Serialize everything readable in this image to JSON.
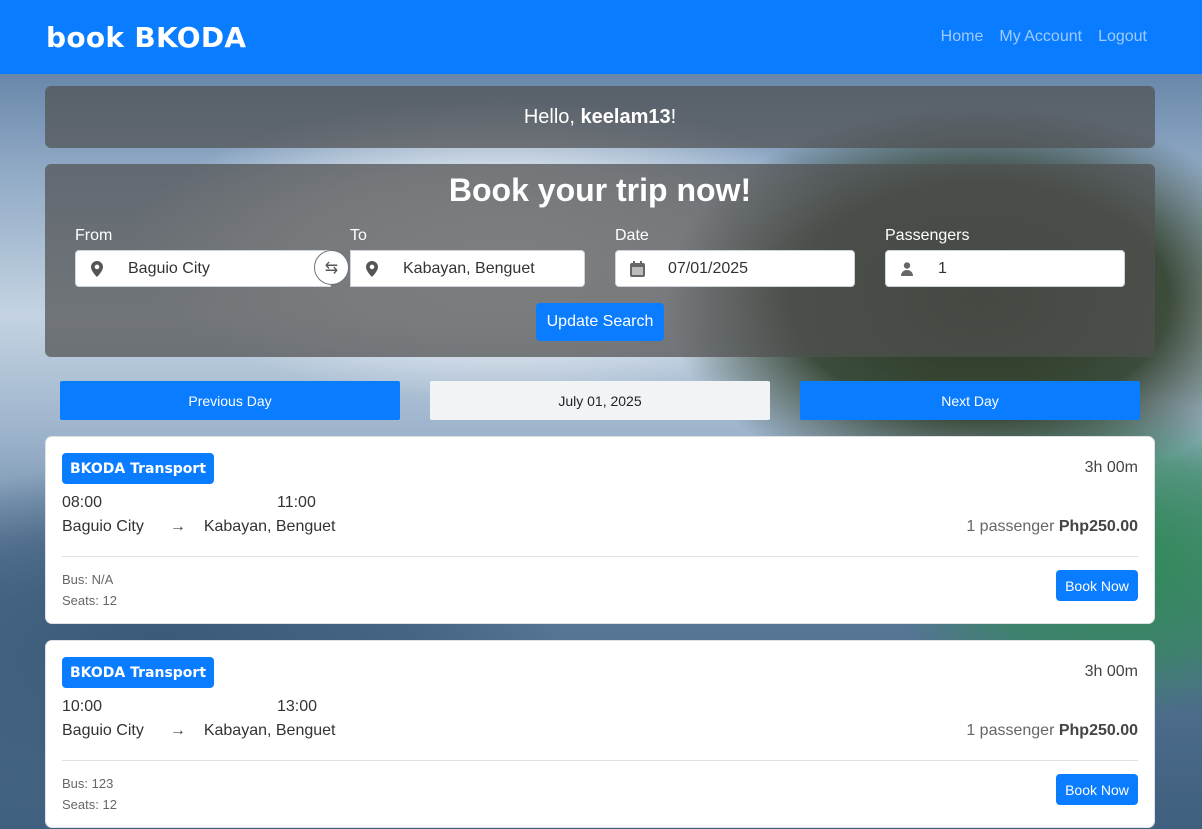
{
  "navbar": {
    "brand": "book BKODA",
    "links": [
      "Home",
      "My Account",
      "Logout"
    ]
  },
  "greeting": {
    "prefix": "Hello, ",
    "username": "keelam13",
    "suffix": "!"
  },
  "search": {
    "title": "Book your trip now!",
    "from_label": "From",
    "from_value": "Baguio City",
    "to_label": "To",
    "to_value": "Kabayan, Benguet",
    "date_label": "Date",
    "date_value": "07/01/2025",
    "passengers_label": "Passengers",
    "passengers_value": "1",
    "update_button": "Update Search"
  },
  "day_nav": {
    "previous": "Previous Day",
    "current": "July 01, 2025",
    "next": "Next Day"
  },
  "trips": [
    {
      "company": "BKODA Transport",
      "duration": "3h 00m",
      "departure_time": "08:00",
      "arrival_time": "11:00",
      "origin": "Baguio City",
      "arrow": "→",
      "destination": "Kabayan, Benguet",
      "passengers": "1 passenger",
      "price": "Php250.00",
      "bus": "Bus: N/A",
      "seats": "Seats: 12",
      "book_button": "Book Now"
    },
    {
      "company": "BKODA Transport",
      "duration": "3h 00m",
      "departure_time": "10:00",
      "arrival_time": "13:00",
      "origin": "Baguio City",
      "arrow": "→",
      "destination": "Kabayan, Benguet",
      "passengers": "1 passenger",
      "price": "Php250.00",
      "bus": "Bus: 123",
      "seats": "Seats: 12",
      "book_button": "Book Now"
    }
  ],
  "colors": {
    "primary": "#0a7cff"
  }
}
